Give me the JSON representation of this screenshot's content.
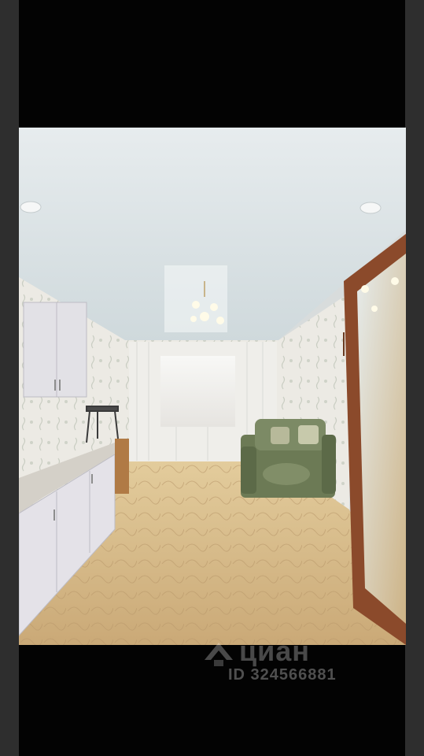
{
  "watermark": {
    "brand": "циан",
    "listing_id": "ID 324566881",
    "logo_icon": "cian-logo-icon"
  },
  "photo": {
    "subject": "room-interior"
  },
  "colors": {
    "frame_background": "#030303",
    "side_bars": "#2e2e2e",
    "ceiling": "#dfe6e8",
    "wallpaper": "#ecebe6",
    "carpet": "#d9bf8f",
    "sofa": "#6c7a55",
    "mirror_frame": "#8b4a2b"
  }
}
